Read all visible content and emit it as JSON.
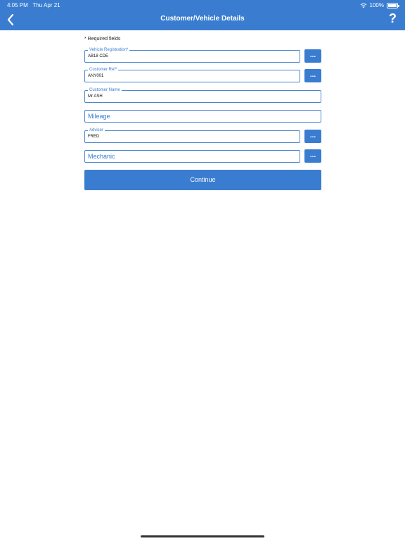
{
  "status_bar": {
    "time": "4:05 PM",
    "date": "Thu Apr 21",
    "battery": "100%"
  },
  "header": {
    "title": "Customer/Vehicle Details",
    "help": "?"
  },
  "form": {
    "required_note": "* Required fields",
    "vehicle_registration": {
      "label": "Vehicle Registration*",
      "value": "AB18 CDE"
    },
    "customer_ref": {
      "label": "Customer Ref*",
      "value": "ANY001"
    },
    "customer_name": {
      "label": "Customer Name",
      "value": "Mr ASH"
    },
    "mileage": {
      "placeholder": "Mileage"
    },
    "adviser": {
      "label": "Adviser",
      "value": "FRED"
    },
    "mechanic": {
      "placeholder": "Mechanic"
    },
    "lookup_label": "...",
    "continue_label": "Continue"
  },
  "colors": {
    "accent": "#3a7dd0",
    "header_bg": "#3a7dd0",
    "background": "#ffffff"
  }
}
